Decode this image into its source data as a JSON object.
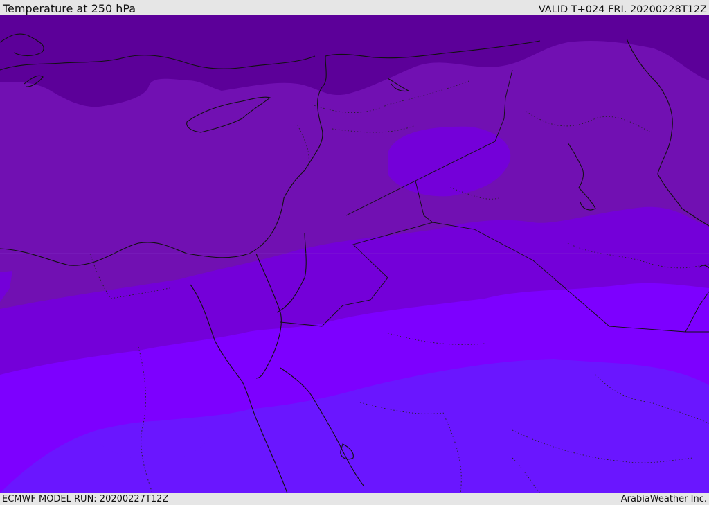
{
  "header": {
    "title": "Temperature at 250 hPa",
    "valid": "VALID T+024 FRI. 20200228T12Z"
  },
  "footer": {
    "model_run": "ECMWF MODEL RUN: 20200227T12Z",
    "credit": "ArabiaWeather Inc."
  },
  "map": {
    "field": "temperature-250hPa",
    "bands": [
      {
        "id": "coldest",
        "color": "#5c0099"
      },
      {
        "id": "cold",
        "color": "#7110b2"
      },
      {
        "id": "mid-purple",
        "color": "#7400d9"
      },
      {
        "id": "violet",
        "color": "#7d00ff"
      },
      {
        "id": "blue-violet",
        "color": "#6a16ff"
      }
    ],
    "coastline_color": "#111111",
    "border_style": "dotted"
  }
}
